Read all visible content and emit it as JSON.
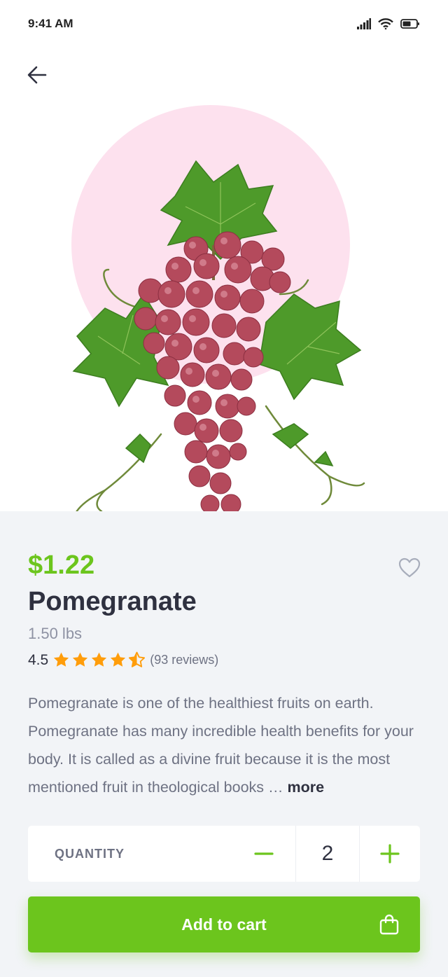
{
  "status_bar": {
    "time": "9:41 AM"
  },
  "product": {
    "price": "$1.22",
    "name": "Pomegranate",
    "weight": "1.50 lbs",
    "rating": "4.5",
    "rating_value": 4.5,
    "reviews": "(93 reviews)",
    "description": "Pomegranate is one of the healthiest fruits on earth. Pomegranate has many incredible health benefits for your body. It is called as a divine fruit because it is the most mentioned fruit in theological books …",
    "more_label": "more",
    "image": "grapes-bunch-image"
  },
  "quantity": {
    "label": "QUANTITY",
    "value": "2"
  },
  "cart": {
    "label": "Add to cart"
  },
  "colors": {
    "accent": "#6cc51d",
    "star": "#ff9d0b",
    "hero_bg": "#fde1ee",
    "panel_bg": "#f2f4f7"
  },
  "icons": [
    "signal-icon",
    "wifi-icon",
    "battery-icon",
    "back-arrow-icon",
    "heart-icon",
    "star-icon",
    "star-half-icon",
    "minus-icon",
    "plus-icon",
    "shopping-bag-icon"
  ]
}
